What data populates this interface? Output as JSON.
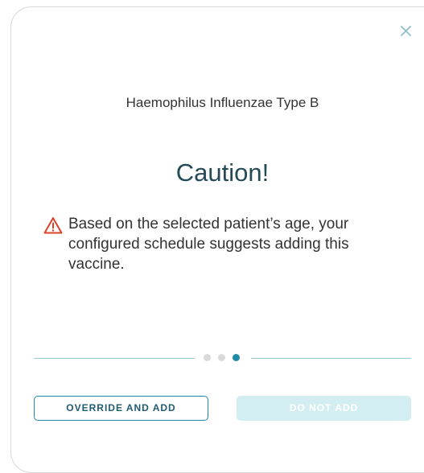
{
  "dialog": {
    "close_icon": "close-icon",
    "vaccine_name": "Haemophilus Influenzae Type B",
    "title": "Caution!",
    "warning_icon": "warning-triangle-icon",
    "message": "Based on the selected patient’s age, your configured schedule suggests adding this vaccine."
  },
  "stepper": {
    "total_steps": 3,
    "active_step": 3
  },
  "buttons": {
    "override_label": "OVERRIDE AND ADD",
    "do_not_add_label": "DO NOT ADD"
  },
  "colors": {
    "accent": "#1f8ba8",
    "title": "#244a56",
    "warning": "#d9432b",
    "inactive_dot": "#d9d9d9",
    "active_dot": "#1f8ba8",
    "disabled_button": "#d3eef2"
  }
}
